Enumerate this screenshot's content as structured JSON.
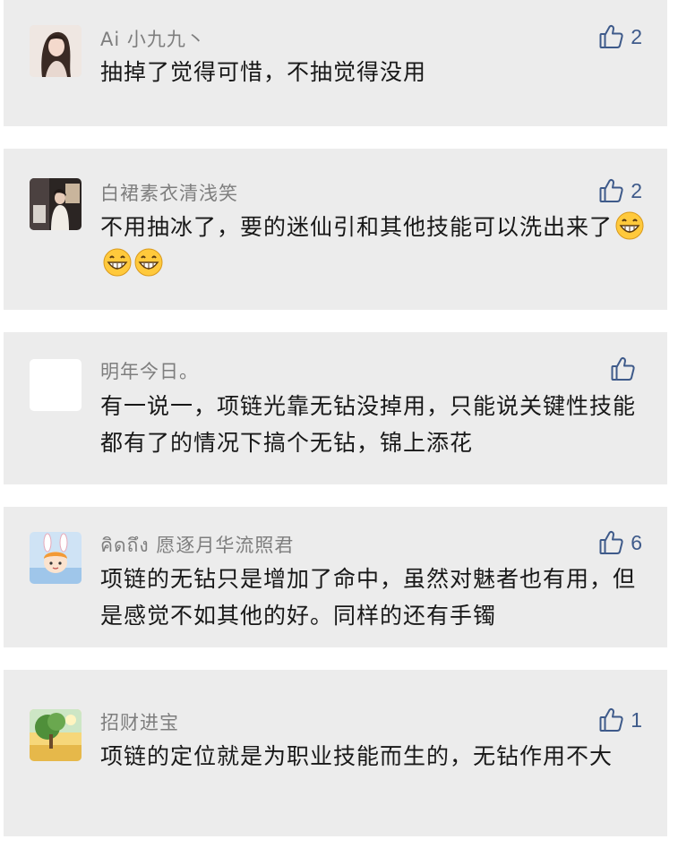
{
  "comments": [
    {
      "user": "Ai 小九九丶",
      "text": "抽掉了觉得可惜，不抽觉得没用",
      "likes": "2",
      "avatar": "girl-portrait"
    },
    {
      "user": "白裙素衣清浅笑",
      "text": "不用抽冰了，要的迷仙引和其他技能可以洗出来了",
      "emoji": [
        "grinning-face",
        "grinning-face",
        "grinning-face"
      ],
      "likes": "2",
      "avatar": "room-photo"
    },
    {
      "user": "明年今日。",
      "text": "有一说一，项链光靠无钻没掉用，只能说关键性技能都有了的情况下搞个无钻，锦上添花",
      "likes": "",
      "avatar": "blank"
    },
    {
      "user": "คิดถึง 愿逐月华流照君",
      "text": "项链的无钻只是增加了命中，虽然对魅者也有用，但是感觉不如其他的好。同样的还有手镯",
      "likes": "6",
      "avatar": "cartoon-bunny"
    },
    {
      "user": "招财进宝",
      "text": "项链的定位就是为职业技能而生的，无钻作用不大",
      "likes": "1",
      "avatar": "tree-landscape"
    }
  ],
  "colors": {
    "card_bg": "#ececec",
    "like_blue": "#3e5a8a",
    "username_gray": "#7e7e7e",
    "text": "#181818"
  }
}
